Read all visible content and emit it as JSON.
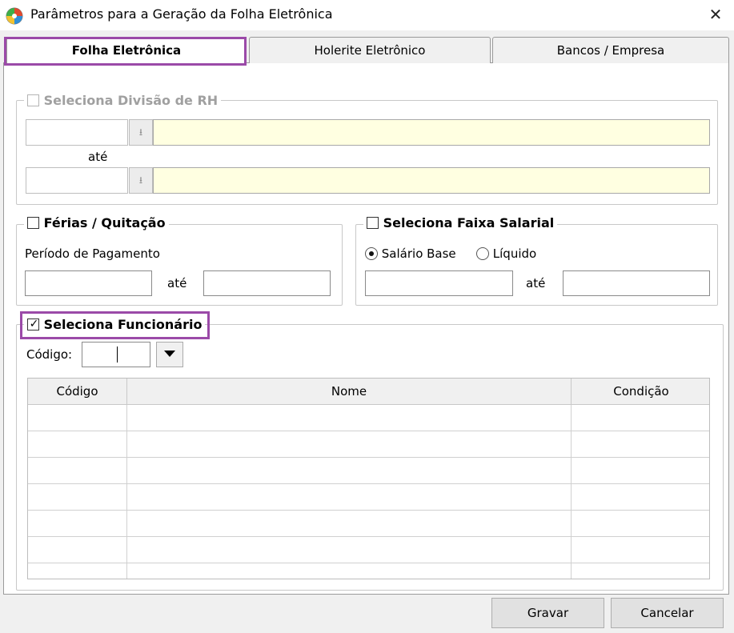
{
  "window": {
    "title": "Parâmetros para a Geração da Folha Eletrônica",
    "close_glyph": "✕",
    "icon": "app-globe-icon"
  },
  "tabs": [
    {
      "label": "Folha Eletrônica",
      "active": true
    },
    {
      "label": "Holerite Eletrônico",
      "active": false
    },
    {
      "label": "Bancos / Empresa",
      "active": false
    }
  ],
  "divisao_rh": {
    "legend": "Seleciona Divisão de RH",
    "checked": false,
    "enabled": false,
    "ate_label": "até",
    "from_code": "",
    "from_desc": "",
    "to_code": "",
    "to_desc": "",
    "lookup_glyph": "⭳"
  },
  "ferias": {
    "legend": "Férias / Quitação",
    "checked": false,
    "periodo_label": "Período de Pagamento",
    "ate_label": "até",
    "from_value": "",
    "to_value": ""
  },
  "faixa_salarial": {
    "legend": "Seleciona Faixa Salarial",
    "checked": false,
    "radio_salario_base": "Salário Base",
    "radio_liquido": "Líquido",
    "selected": "Salário Base",
    "ate_label": "até",
    "from_value": "",
    "to_value": ""
  },
  "funcionario": {
    "legend": "Seleciona Funcionário",
    "checked": true,
    "check_glyph": "✓",
    "codigo_label": "Código:",
    "codigo_value": ""
  },
  "grid": {
    "columns": [
      "Código",
      "Nome",
      "Condição"
    ],
    "row_count": 7
  },
  "buttons": {
    "save": "Gravar",
    "cancel": "Cancelar"
  },
  "colors": {
    "highlight": "#9b4aa8",
    "lookup_field": "#ffffe1"
  }
}
